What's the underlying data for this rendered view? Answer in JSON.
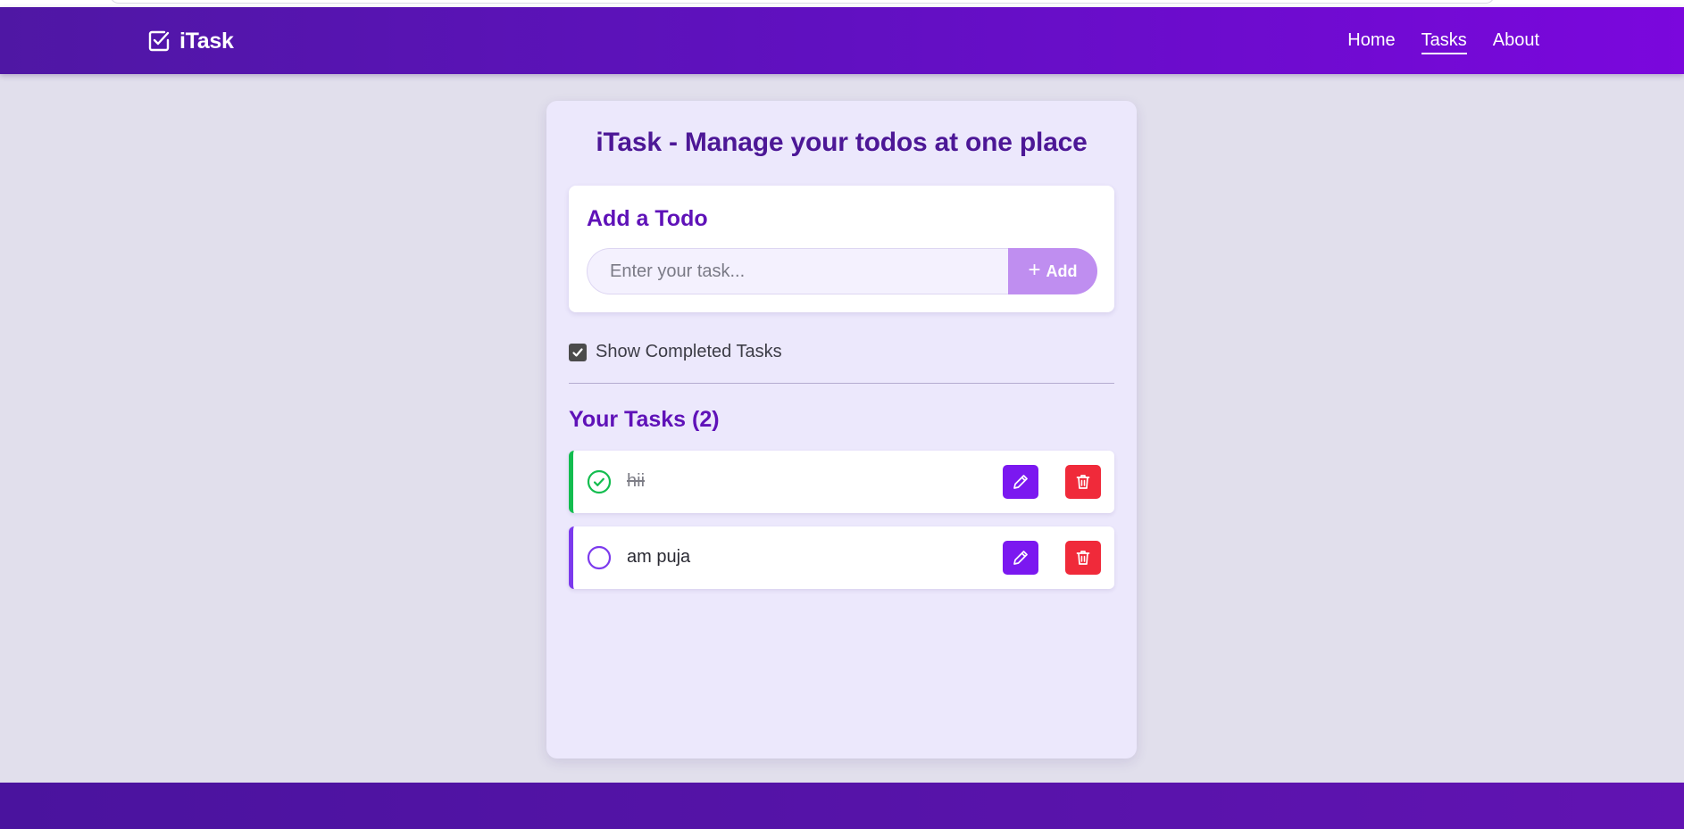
{
  "app": {
    "brand": "iTask",
    "colors": {
      "nav_gradient": [
        "#4f17a4",
        "#7b07dd"
      ],
      "accent": "#5f12b8",
      "done": "#13bd4f",
      "pending": "#7c3aed",
      "edit": "#7b18f0",
      "delete": "#f02a3a"
    }
  },
  "nav": {
    "links": [
      {
        "label": "Home",
        "active": false
      },
      {
        "label": "Tasks",
        "active": true
      },
      {
        "label": "About",
        "active": false
      }
    ]
  },
  "main": {
    "title": "iTask - Manage your todos at one place",
    "add_card": {
      "heading": "Add a Todo",
      "input_placeholder": "Enter your task...",
      "input_value": "",
      "add_button_label": "Add",
      "add_icon": "plus-icon"
    },
    "show_completed": {
      "label": "Show Completed Tasks",
      "checked": true
    },
    "tasks_heading": "Your Tasks (2)",
    "tasks": [
      {
        "text": "hii",
        "completed": true,
        "status_icon": "check-circle-icon",
        "edit_icon": "pencil-icon",
        "delete_icon": "trash-icon"
      },
      {
        "text": "am puja",
        "completed": false,
        "status_icon": "empty-circle-icon",
        "edit_icon": "pencil-icon",
        "delete_icon": "trash-icon"
      }
    ]
  }
}
